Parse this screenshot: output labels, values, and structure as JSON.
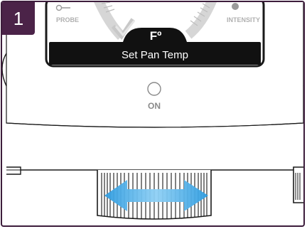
{
  "step": {
    "number": "1"
  },
  "display": {
    "probe_label": "PROBE",
    "intensity_label": "INTENSITY",
    "unit_label": "Fº",
    "mode_label": "Set Pan Temp"
  },
  "power": {
    "label": "ON"
  },
  "icons": {
    "probe": "probe-icon",
    "intensity": "intensity-dot-icon",
    "dial": "dial-arc-icon",
    "power": "power-circle-icon",
    "knob_arrow": "double-arrow-icon"
  },
  "colors": {
    "frame": "#3d1d3c",
    "badge": "#4b2348",
    "arrow": "#3aa6e6",
    "outline": "#1a1a1a"
  }
}
